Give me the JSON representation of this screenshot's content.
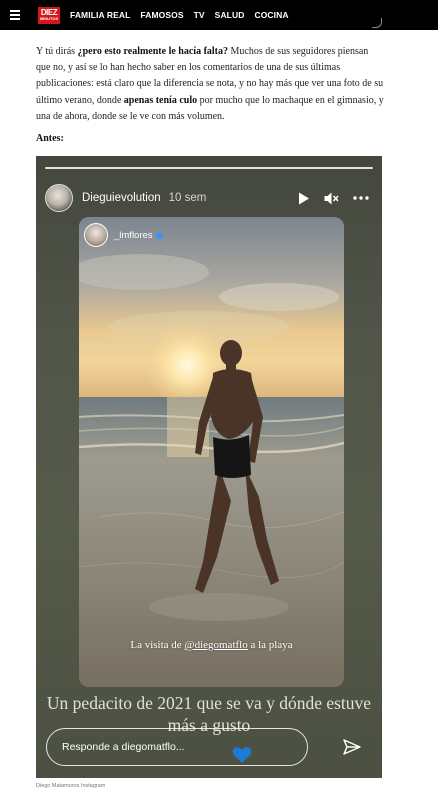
{
  "nav": {
    "logo_line1": "DIEZ",
    "logo_line2": "MINUTOS",
    "links": [
      "FAMILIA REAL",
      "FAMOSOS",
      "TV",
      "SALUD",
      "COCINA"
    ]
  },
  "article": {
    "p1_a": "Y tú dirás ",
    "p1_b": "¿pero esto realmente le hacía falta?",
    "p1_c": " Muchos de sus seguidores piensan que no, y así se lo han hecho saber en los comentarios de una de sus últimas publicaciones: está claro que la diferencia se nota, y no hay más que ver una foto de su último verano, donde ",
    "p1_d": "apenas tenía culo",
    "p1_e": " por mucho que lo machaque en el gimnasio, y una de ahora, donde se le ve con más volumen.",
    "antes": "Antes:"
  },
  "story": {
    "username": "Dieguievolution",
    "time_ago": "10 sem",
    "inner_username": "_lmflores",
    "inner_caption_a": "La visita de ",
    "inner_caption_mention": "@diegomatflo",
    "inner_caption_b": " a la playa",
    "big_caption": "Un pedacito de 2021 que se va y dónde estuve más a gusto",
    "reply_placeholder": "Responde a diegomatflo..."
  },
  "credit": "Diego Matamoros Instagram",
  "colors": {
    "navbar": "#000000",
    "logo_red": "#d8151b",
    "verified_blue": "#3897f0",
    "heart_blue": "#1d7bd6"
  },
  "icons": [
    "menu-icon",
    "play-icon",
    "mute-icon",
    "more-icon",
    "verified-icon",
    "heart-icon",
    "send-icon"
  ]
}
